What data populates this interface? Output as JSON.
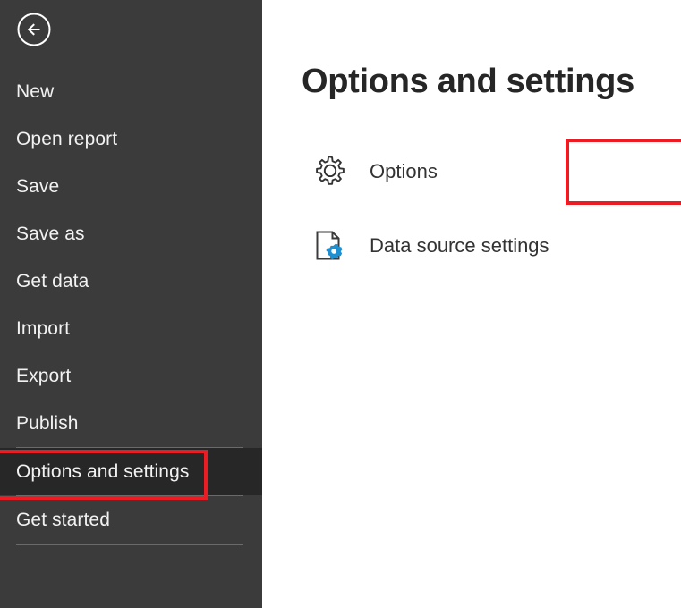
{
  "window": {
    "app": "Power BI Desktop backstage",
    "background_color": "#ffffff"
  },
  "sidebar": {
    "background_color": "#3b3b3b",
    "selected_background_color": "#272727",
    "text_color": "#f2f2f2",
    "back_button": {
      "icon": "back-arrow-circle-icon",
      "label": "Back"
    },
    "items": [
      {
        "label": "New",
        "selected": false,
        "separator_after": false
      },
      {
        "label": "Open report",
        "selected": false,
        "separator_after": false
      },
      {
        "label": "Save",
        "selected": false,
        "separator_after": false
      },
      {
        "label": "Save as",
        "selected": false,
        "separator_after": false
      },
      {
        "label": "Get data",
        "selected": false,
        "separator_after": false
      },
      {
        "label": "Import",
        "selected": false,
        "separator_after": false
      },
      {
        "label": "Export",
        "selected": false,
        "separator_after": false
      },
      {
        "label": "Publish",
        "selected": false,
        "separator_after": true
      },
      {
        "label": "Options and settings",
        "selected": true,
        "separator_after": true
      },
      {
        "label": "Get started",
        "selected": false,
        "separator_after": true
      }
    ]
  },
  "content": {
    "title": "Options and settings",
    "title_color": "#262626",
    "actions": [
      {
        "label": "Options",
        "icon": "gear-icon",
        "icon_color": "#333333"
      },
      {
        "label": "Data source settings",
        "icon": "document-gear-icon",
        "icon_color": "#333333",
        "icon_accent_color": "#1e90d2"
      }
    ]
  },
  "annotations": {
    "color": "#ec1c24",
    "boxes": [
      {
        "target": "sidebar-item-options-and-settings"
      },
      {
        "target": "options-action-button"
      }
    ]
  }
}
